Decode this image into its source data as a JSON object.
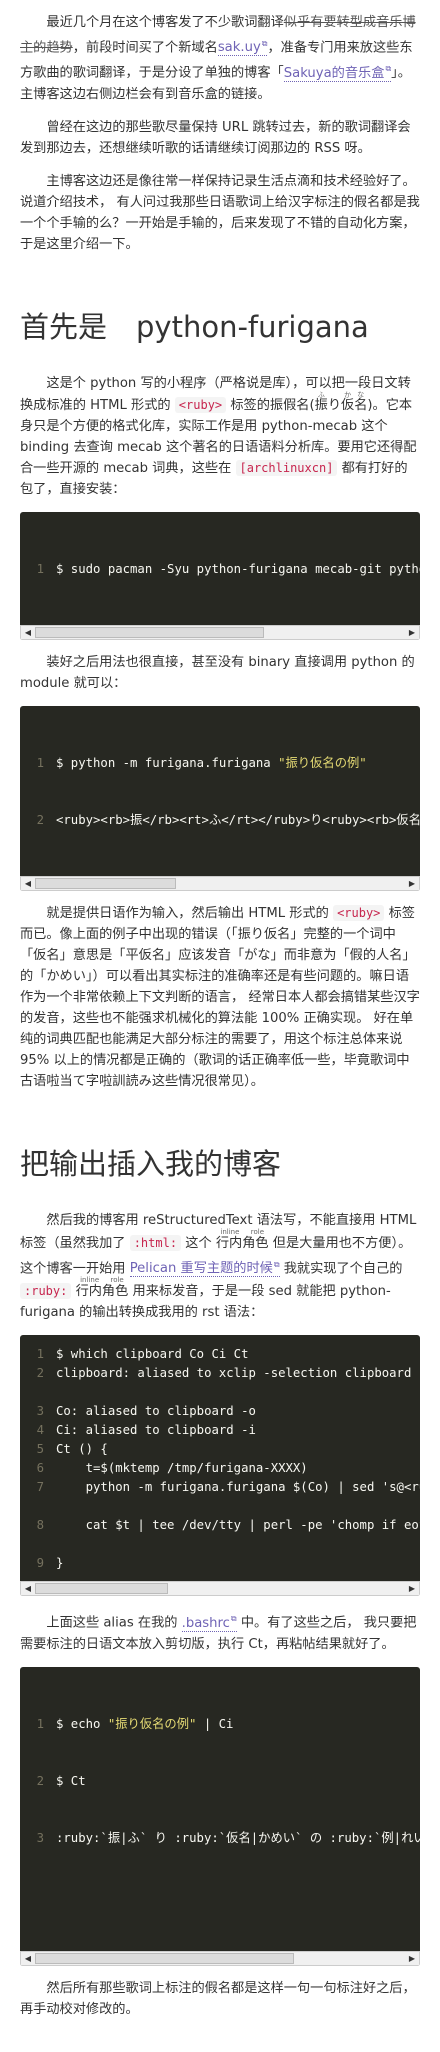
{
  "intro": {
    "p1_a": "最近几个月在这个博客发了不少歌词翻译",
    "p1_strike": "似乎有要转型成音乐博主的趋势",
    "p1_b": "，前段时间买了个新域名",
    "p1_link1": "sak.uy",
    "p1_c": "，准备专门用来放这些东方歌曲的歌词翻译，于是分设了单独的博客「",
    "p1_link2": "Sakuya的音乐盒",
    "p1_d": "」。主博客这边右侧边栏会有到音乐盒的链接。",
    "p2": "曾经在这边的那些歌尽量保持 URL 跳转过去，新的歌词翻译会发到那边去，还想继续听歌的话请继续订阅那边的 RSS 呀。",
    "p3": "主博客这边还是像往常一样保持记录生活点滴和技术经验好了。说道介绍技术， 有人问过我那些日语歌词上给汉字标注的假名都是我一个个手输的么？一开始是手输的，后来发现了不错的自动化方案，于是这里介绍一下。"
  },
  "section1": {
    "heading": "首先是　python-furigana",
    "p1_a": "这是个 python 写的小程序（严格说是库），可以把一段日文转换成标准的 HTML 形式的",
    "p1_code": "<ruby>",
    "p1_b": "标签的振假名(",
    "ruby_base1": "振",
    "ruby_rt1": "ふ",
    "ruby_mid": "り",
    "ruby_base2": "仮名",
    "ruby_rt2": "かな",
    "p1_c": ")。它本身只是个方便的格式化库，实际工作是用 python-mecab 这个 binding 去查询 mecab 这个著名的日语语料分析库。要用它还得配合一些开源的 mecab 词典，这些在",
    "p1_code2": "[archlinuxcn]",
    "p1_d": "都有打好的包了，直接安装：",
    "code1": [
      {
        "n": "1",
        "t": "$ sudo pacman -Syu python-furigana mecab-git python-mecab mecab-ipadic"
      }
    ],
    "p2": "装好之后用法也很直接，甚至没有 binary 直接调用 python 的 module 就可以：",
    "code2_l1_a": "$ python -m furigana.furigana ",
    "code2_l1_str": "\"振り仮名の例\"",
    "code2_l2": "<ruby><rb>振</rb><rt>ふ</rt></ruby>り<ruby><rb>仮名</rb><rt>かな</rt></ruby>の<ruby><rb>例</rb><rt>れい</rt></ruby>",
    "p3_a": "就是提供日语作为输入，然后输出 HTML 形式的",
    "p3_code": "<ruby>",
    "p3_b": "标签而已。像上面的例子中出现的错误（「振り仮名」完整的一个词中「仮名」意思是「平仮名」应该发音「がな」而非意为「假的人名」的「かめい」）可以看出其实标注的准确率还是有些问题的。嘛日语作为一个非常依赖上下文判断的语言， 经常日本人都会搞错某些汉字的发音，这些也不能强求机械化的算法能 100% 正确实现。 好在单纯的词典匹配也能满足大部分标注的需要了，用这个标注总体来说 95% 以上的情况都是正确的（歌词的话正确率低一些，毕竟歌词中古语啦当て字啦訓読み这些情况很常见）。"
  },
  "section2": {
    "heading": "把输出插入我的博客",
    "p1_a": "然后我的博客用 reStructuredText 语法写，不能直接用 HTML 标签（虽然我加了",
    "p1_code": ":html:",
    "p1_b": "这个",
    "ruby1_base": "行内角色",
    "ruby1_rt_a": "inline",
    "ruby1_rt_b": "role",
    "p1_c": "但是大量用也不方便）。这个博客一开始用",
    "p1_link": "Pelican 重写主题的时候",
    "p1_d": "我就实现了个自己的",
    "p1_code2": ":ruby:",
    "ruby2_base": "行内角色",
    "ruby2_rt_a": "inline",
    "ruby2_rt_b": "role",
    "p1_e": "用来标发音，于是一段 sed 就能把 python-furigana 的输出转换成我用的 rst 语法：",
    "code3": [
      {
        "n": "1",
        "t": "$ which clipboard Co Ci Ct",
        "tall": false
      },
      {
        "n": "2",
        "t": "clipboard: aliased to xclip -selection clipboard",
        "tall": true
      },
      {
        "n": "3",
        "t": "Co: aliased to clipboard -o",
        "tall": false
      },
      {
        "n": "4",
        "t": "Ci: aliased to clipboard -i",
        "tall": false
      },
      {
        "n": "5",
        "t": "Ct () {",
        "tall": false
      },
      {
        "n": "6",
        "t": "    t=$(mktemp /tmp/furigana-XXXX)",
        "tall": false
      },
      {
        "n": "7",
        "t": "    python -m furigana.furigana $(Co) | sed 's@<ruby><rb>@ :ruby:`@g;s@</rb><rt>@|@g;s@</rt></ruby>@` @g' | sponge $t",
        "tall": true
      },
      {
        "n": "8",
        "t": "    cat $t | tee /dev/tty | perl -pe 'chomp if eof' | Ci",
        "tall": true
      },
      {
        "n": "9",
        "t": "}",
        "tall": false
      }
    ],
    "p2_a": "上面这些 alias 在我的",
    "p2_link": ".bashrc",
    "p2_b": "中。有了这些之后， 我只要把需要标注的日语文本放入剪切版，执行 Ct，再粘帖结果就好了。",
    "code4_l1_a": "$ echo ",
    "code4_l1_str": "\"振り仮名の例\"",
    "code4_l1_b": " | Ci",
    "code4_l2": "$ Ct",
    "code4_l3": ":ruby:`振|ふ` り :ruby:`仮名|かめい` の :ruby:`例|れい`",
    "p3": "然后所有那些歌词上标注的假名都是这样一句一句标注好之后，再手动校对修改的。"
  },
  "scrollbar": {
    "left": "◀",
    "right": "▶"
  }
}
